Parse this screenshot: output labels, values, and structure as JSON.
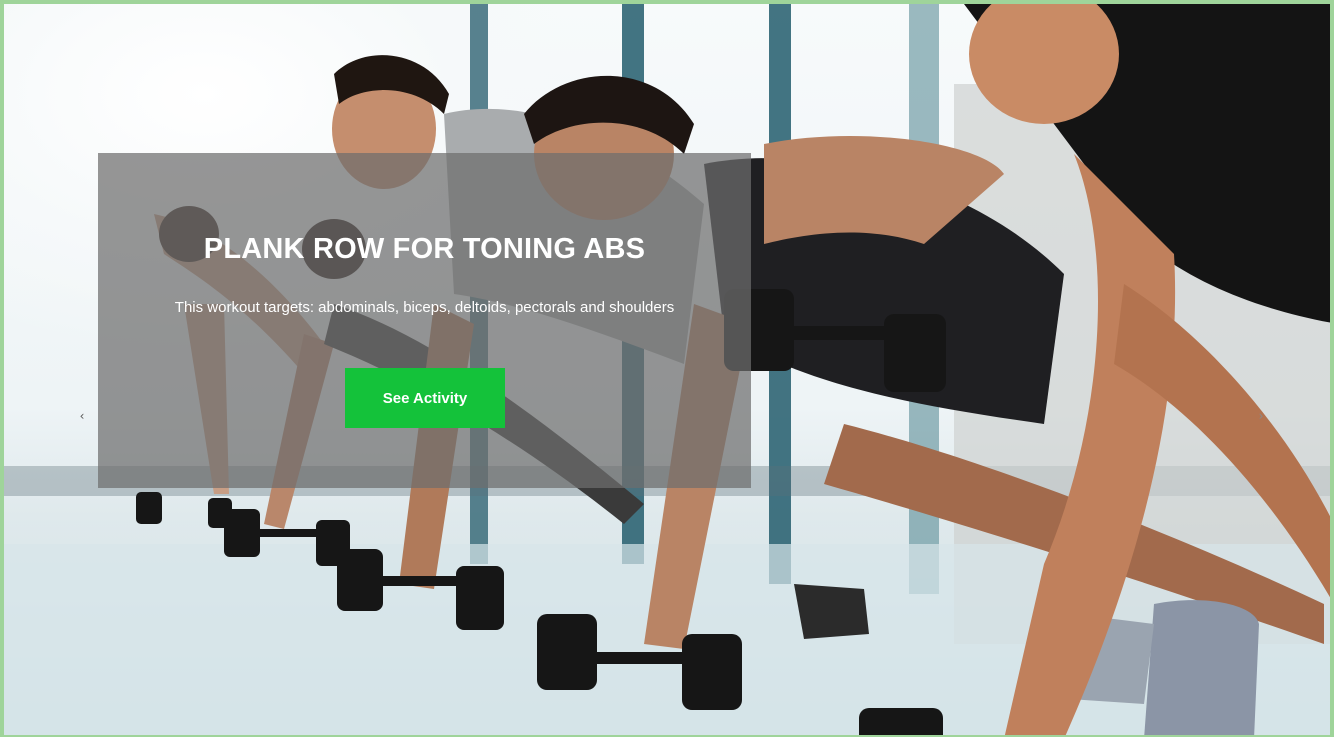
{
  "slide": {
    "title": "PLANK ROW FOR TONING ABS",
    "description": "This workout targets: abdominals, biceps, deltoids, pectorals and shoulders",
    "cta_label": "See Activity"
  },
  "carousel": {
    "prev_glyph": "‹",
    "next_glyph": "›"
  },
  "colors": {
    "frame_border": "#9fd49a",
    "overlay": "#6e6e6e",
    "cta_background": "#14c23a",
    "text": "#ffffff"
  },
  "icons": {
    "prev": "chevron-left-icon",
    "next": "chevron-right-icon"
  }
}
